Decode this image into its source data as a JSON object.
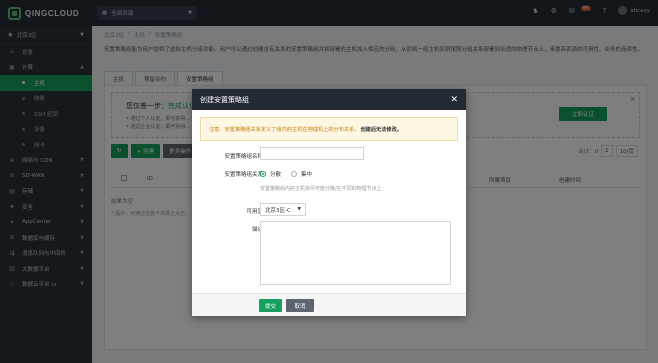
{
  "topbar": {
    "logo": "QINGCLOUD",
    "project": "全部资源",
    "badge": "99",
    "user": "abcaxy"
  },
  "sidebar": {
    "region": "北京3区",
    "items": [
      {
        "label": "总览",
        "icon": "home-icon"
      },
      {
        "label": "计算",
        "icon": "compute-icon",
        "expanded": true
      },
      {
        "label": "主机",
        "sub": true,
        "active": true
      },
      {
        "label": "映像",
        "sub": true
      },
      {
        "label": "SSH 密钥",
        "sub": true
      },
      {
        "label": "设备",
        "sub": true
      },
      {
        "label": "网卡",
        "sub": true
      },
      {
        "label": "网络与 CDN",
        "icon": "network-icon"
      },
      {
        "label": "SD-WAN",
        "icon": "sdwan-icon"
      },
      {
        "label": "存储",
        "icon": "storage-icon"
      },
      {
        "label": "安全",
        "icon": "security-icon"
      },
      {
        "label": "AppCenter",
        "icon": "appcenter-icon"
      },
      {
        "label": "数据库与缓存",
        "icon": "database-icon"
      },
      {
        "label": "消息队列与中间件",
        "icon": "queue-icon"
      },
      {
        "label": "大数据平台",
        "icon": "bigdata-icon"
      },
      {
        "label": "数据云平台 (x",
        "icon": "dataplatform-icon"
      }
    ]
  },
  "main": {
    "breadcrumb": [
      "北京3区",
      "/",
      "主机",
      "/",
      "安置策略组"
    ],
    "description": "安置策略组能为用户提供了虚拟主机分组功能。用户可以通过创建含有关系的安置策略组并将部署的主机加入相应的分组，从而将一组主机实例按照分组关系部署到合适的物理节点上，来提高资源的可用性、业务的连续性。",
    "tabs": [
      "主机",
      "预留合约",
      "安置策略组"
    ],
    "active_tab": 2,
    "guide": {
      "title_prefix": "您仅差一步：",
      "title_highlight": "完成认证",
      "line1": "• 通过个人认证，即可获得...",
      "line2": "• 通过企业认证，即可获得...",
      "button": "立即认证"
    },
    "toolbar": {
      "refresh": "↻",
      "create": "+ 创建",
      "more": "更多操作"
    },
    "pager": {
      "total": "合计：0",
      "page": "1",
      "per_page": "10/页"
    },
    "table_headers": [
      "ID",
      "所属项目",
      "创建时间"
    ],
    "result_label": "结果为空",
    "hint": "* 提示：可通过在各个资源上点击..."
  },
  "modal": {
    "title": "创建安置策略组",
    "warning_text": "注意：安置策略组关系定义了组内的主机在物理机上的分布关系，",
    "warning_bold": "创建后无法修改。",
    "name_label": "安置策略组名称",
    "name_value": "",
    "relation_label": "安置策略组关系",
    "option_spread": "分散",
    "option_gather": "集中",
    "relation_help": "安置策略组内的主机将尽可能分散/在不同的物理节点上",
    "zone_label": "可用区",
    "zone_value": "北京3区-C",
    "desc_label": "描述",
    "desc_value": "",
    "submit": "提交",
    "cancel": "取消"
  }
}
